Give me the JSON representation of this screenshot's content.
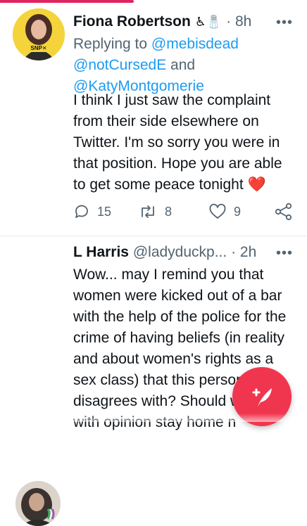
{
  "tweets": [
    {
      "author_name": "Fiona Robertson",
      "badge_emojis": "♿🧂",
      "separator": "·",
      "time": "8h",
      "more": "•••",
      "avatar_label": "SNP✕",
      "replying_prefix": "Replying to ",
      "mention_1": "@mebisdead",
      "mention_2": "@notCursedE",
      "mention_joiner": " and",
      "mention_3": "@KatyMontgomerie",
      "text_lines": [
        "I think I just saw the complaint",
        "from their side elsewhere on",
        "Twitter. I'm so sorry you were in",
        "that position. Hope you are able",
        "to get some peace tonight"
      ],
      "heart_emoji": "❤️",
      "replies": "15",
      "retweets": "8",
      "likes": "9"
    },
    {
      "author_name": "L Harris",
      "handle": "@ladyduckp...",
      "separator": "·",
      "time": "2h",
      "more": "•••",
      "text_lines": [
        "Wow... may I remind you that",
        "women were kicked out of a bar",
        "with the help of the police for the",
        "crime of having beliefs (in reality",
        "and about women's rights as a",
        "sex class) that this person",
        "disagrees with? Should w",
        "with opinion stay home n"
      ]
    }
  ],
  "icons": {
    "reply": "reply-icon",
    "retweet": "retweet-icon",
    "like": "heart-icon",
    "share": "share-icon",
    "compose": "compose-feather-icon"
  },
  "colors": {
    "link": "#1d9bf0",
    "muted": "#536471",
    "fab": "#f0364e",
    "heart": "#e0245e"
  }
}
